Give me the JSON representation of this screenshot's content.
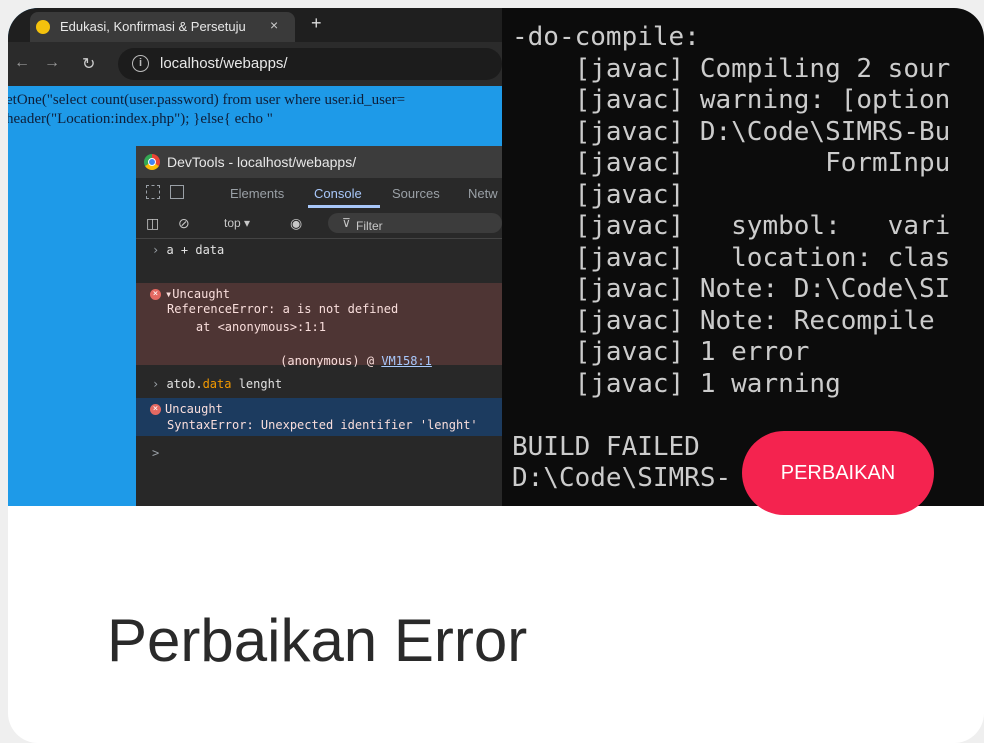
{
  "browser": {
    "tab_title": "Edukasi, Konfirmasi & Persetuju",
    "tab_close": "×",
    "new_tab": "+",
    "url": "localhost/webapps/",
    "page_lines": [
      "etOne(\"select count(user.password) from user where user.id_user=",
      "header(\"Location:index.php\"); }else{ echo \""
    ]
  },
  "devtools": {
    "window_title": "DevTools - localhost/webapps/",
    "tabs": [
      "Elements",
      "Console",
      "Sources",
      "Netw"
    ],
    "active_tab": "Console",
    "context": "top ▾",
    "filter_placeholder": "Filter",
    "console": {
      "input1": "a + data",
      "err1_head": "▾Uncaught",
      "err1_msg": "ReferenceError: a is not defined",
      "err1_at": "    at <anonymous>:1:1",
      "err1_src": "(anonymous) @ ",
      "err1_link": "VM158:1",
      "input2_obj": "atob.",
      "input2_prop": "data",
      "input2_rest": " lenght",
      "err2_head": "Uncaught",
      "err2_msg": "SyntaxError: Unexpected identifier 'lenght'",
      "prompt": ">"
    }
  },
  "terminal": {
    "lines": [
      "-do-compile:",
      "    [javac] Compiling 2 sour",
      "    [javac] warning: [option",
      "    [javac] D:\\Code\\SIMRS-Bu",
      "    [javac]         FormInpu",
      "    [javac]",
      "    [javac]   symbol:   vari",
      "    [javac]   location: clas",
      "    [javac] Note: D:\\Code\\SI",
      "    [javac] Note: Recompile ",
      "    [javac] 1 error",
      "    [javac] 1 warning",
      "",
      "BUILD FAILED",
      "D:\\Code\\SIMRS-      bjec"
    ]
  },
  "badge": "PERBAIKAN",
  "post_title": "Perbaikan Error",
  "colors": {
    "badge": "#f4234f",
    "desktop": "#1e9ae8",
    "terminal_bg": "#0c0c0c"
  }
}
